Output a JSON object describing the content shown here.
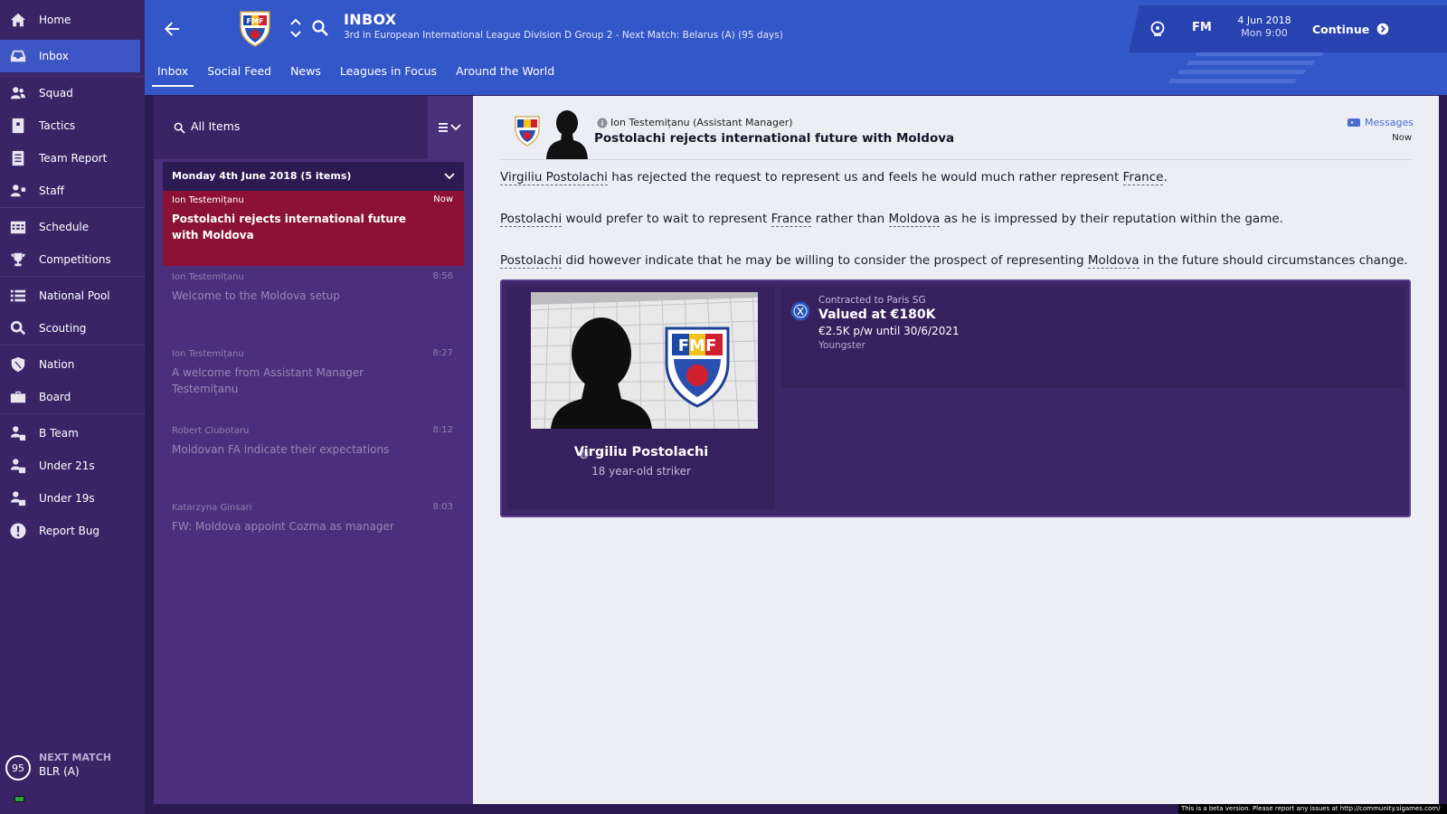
{
  "sidebar": {
    "items": [
      {
        "label": "Home",
        "icon": "home-icon"
      },
      {
        "label": "Inbox",
        "icon": "inbox-icon"
      },
      {
        "label": "Squad",
        "icon": "squad-icon"
      },
      {
        "label": "Tactics",
        "icon": "tactics-icon"
      },
      {
        "label": "Team Report",
        "icon": "report-icon"
      },
      {
        "label": "Staff",
        "icon": "staff-icon"
      },
      {
        "label": "Schedule",
        "icon": "calendar-icon"
      },
      {
        "label": "Competitions",
        "icon": "trophy-icon"
      },
      {
        "label": "National Pool",
        "icon": "list-icon"
      },
      {
        "label": "Scouting",
        "icon": "magnifier-icon"
      },
      {
        "label": "Nation",
        "icon": "shield-icon"
      },
      {
        "label": "Board",
        "icon": "briefcase-icon"
      },
      {
        "label": "B Team",
        "icon": "b-team-icon"
      },
      {
        "label": "Under 21s",
        "icon": "u21-icon"
      },
      {
        "label": "Under 19s",
        "icon": "u19-icon"
      },
      {
        "label": "Report Bug",
        "icon": "exclamation-icon"
      }
    ],
    "active": "Inbox",
    "next_match": {
      "days": "95",
      "label": "NEXT MATCH",
      "value": "BLR (A)"
    }
  },
  "header": {
    "title": "INBOX",
    "subtitle": "3rd in European International League Division D Group 2 - Next Match: Belarus (A) (95 days)",
    "badge_letters": "FMF",
    "tabs": [
      "Inbox",
      "Social Feed",
      "News",
      "Leagues in Focus",
      "Around the World"
    ],
    "active_tab": "Inbox",
    "brand": "FM",
    "date": "4 Jun 2018",
    "time": "Mon 9:00",
    "continue_label": "Continue"
  },
  "inbox": {
    "filter_label": "All Items",
    "date_group": "Monday 4th June 2018 (5 items)",
    "messages": [
      {
        "sender": "Ion Testemițanu",
        "time": "Now",
        "subject": "Postolachi rejects international future with Moldova",
        "selected": true
      },
      {
        "sender": "Ion Testemițanu",
        "time": "8:56",
        "subject": "Welcome to the Moldova setup",
        "selected": false
      },
      {
        "sender": "Ion Testemițanu",
        "time": "8:27",
        "subject": "A welcome from Assistant Manager Testemițanu",
        "selected": false
      },
      {
        "sender": "Robert Ciubotaru",
        "time": "8:12",
        "subject": "Moldovan FA indicate their expectations",
        "selected": false
      },
      {
        "sender": "Katarzyna Ginsari",
        "time": "8:03",
        "subject": "FW: Moldova appoint Cozma as manager",
        "selected": false
      }
    ]
  },
  "message": {
    "from": "Ion Testemițanu  (Assistant Manager)",
    "title": "Postolachi rejects international future with Moldova",
    "messages_link": "Messages",
    "time": "Now",
    "p1": {
      "link1": "Virgiliu Postolachi",
      "text1": " has rejected the request to represent us and feels he would much rather represent ",
      "link2": "France",
      "text2": "."
    },
    "p2": {
      "link1": "Postolachi",
      "text1": " would prefer to wait to represent ",
      "link2": "France",
      "text2": " rather than ",
      "link3": "Moldova",
      "text3": " as he is impressed by their reputation within the game."
    },
    "p3": {
      "link1": "Postolachi",
      "text1": " did however indicate that he may be willing to consider the prospect of representing ",
      "link2": "Moldova",
      "text2": " in the future should circumstances change."
    }
  },
  "player": {
    "name": "Virgiliu Postolachi",
    "description": "18 year-old striker",
    "contract": "Contracted to Paris SG",
    "value": "Valued at €180K",
    "wage": "€2.5K p/w until 30/6/2021",
    "category": "Youngster",
    "badge_letters": "FMF"
  },
  "footer": {
    "beta_note": "This is a beta version. Please report any issues at http://community.sigames.com/"
  },
  "colors": {
    "sidebar": "#3a2466",
    "header": "#3356c8",
    "selected_message": "#8c1235",
    "list_panel": "#4c2f7c",
    "content": "#eceef3"
  }
}
